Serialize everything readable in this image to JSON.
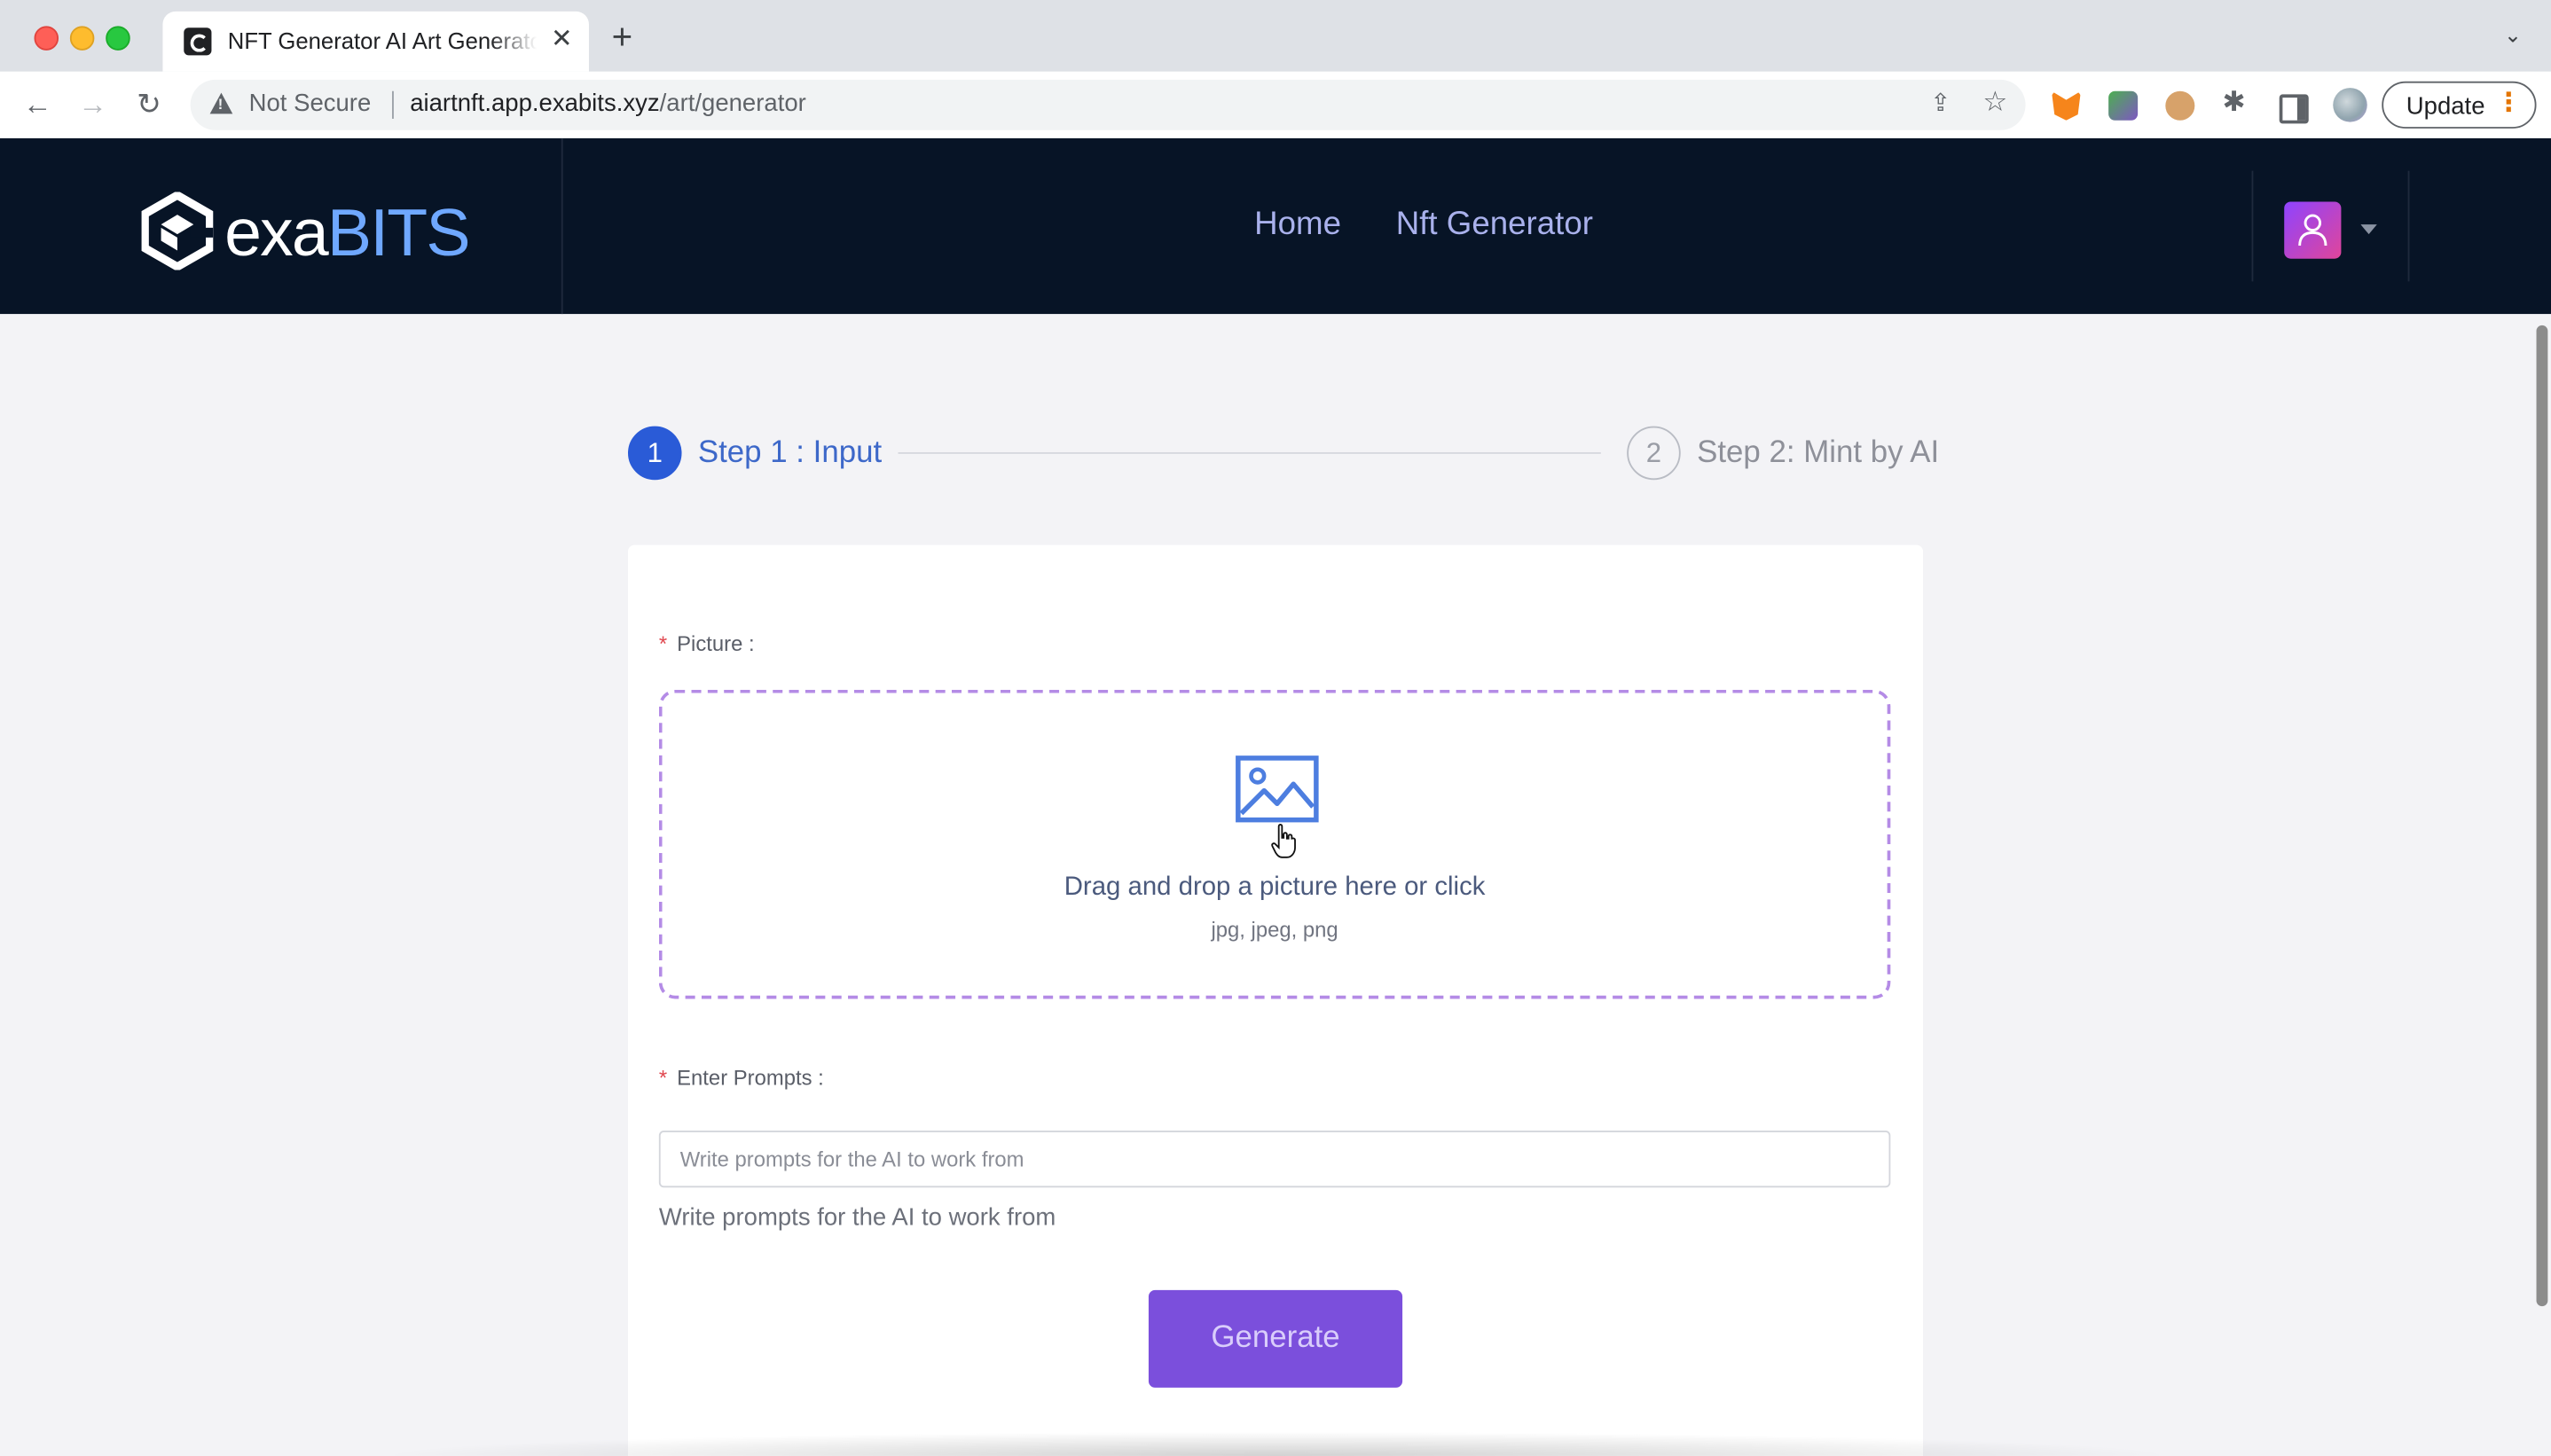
{
  "browser": {
    "tab_title": "NFT Generator AI Art Generator",
    "tab_close": "✕",
    "new_tab": "+",
    "tab_list": "⌄",
    "security_label": "Not Secure",
    "url_host": "aiartnft.app.exabits.xyz",
    "url_path": "/art/generator",
    "update_label": "Update",
    "menu_dots": "⋮",
    "back": "←",
    "forward": "→",
    "reload": "↻",
    "share": "⇪",
    "star": "☆",
    "puzzle": "✱"
  },
  "header": {
    "logo_exa": "exa",
    "logo_bits": "BITS",
    "nav": {
      "home": "Home",
      "generator": "Nft Generator"
    }
  },
  "steps": [
    {
      "number": "1",
      "label": "Step 1 : Input",
      "state": "active"
    },
    {
      "number": "2",
      "label": "Step 2: Mint by AI",
      "state": "pending"
    }
  ],
  "form": {
    "required_mark": "*",
    "picture_label": "Picture :",
    "dropzone_text": "Drag and drop a picture here or click",
    "dropzone_hint": "jpg, jpeg, png",
    "prompts_label": "Enter Prompts :",
    "prompts_value": "",
    "prompts_placeholder": "Write prompts for the AI to work from",
    "prompts_help": "Write prompts for the AI to work from",
    "generate_label": "Generate"
  },
  "colors": {
    "header_bg": "#071426",
    "accent_purple": "#7b4fdc",
    "step_active": "#2a5bd7",
    "dropzone_border": "#b48be6"
  }
}
